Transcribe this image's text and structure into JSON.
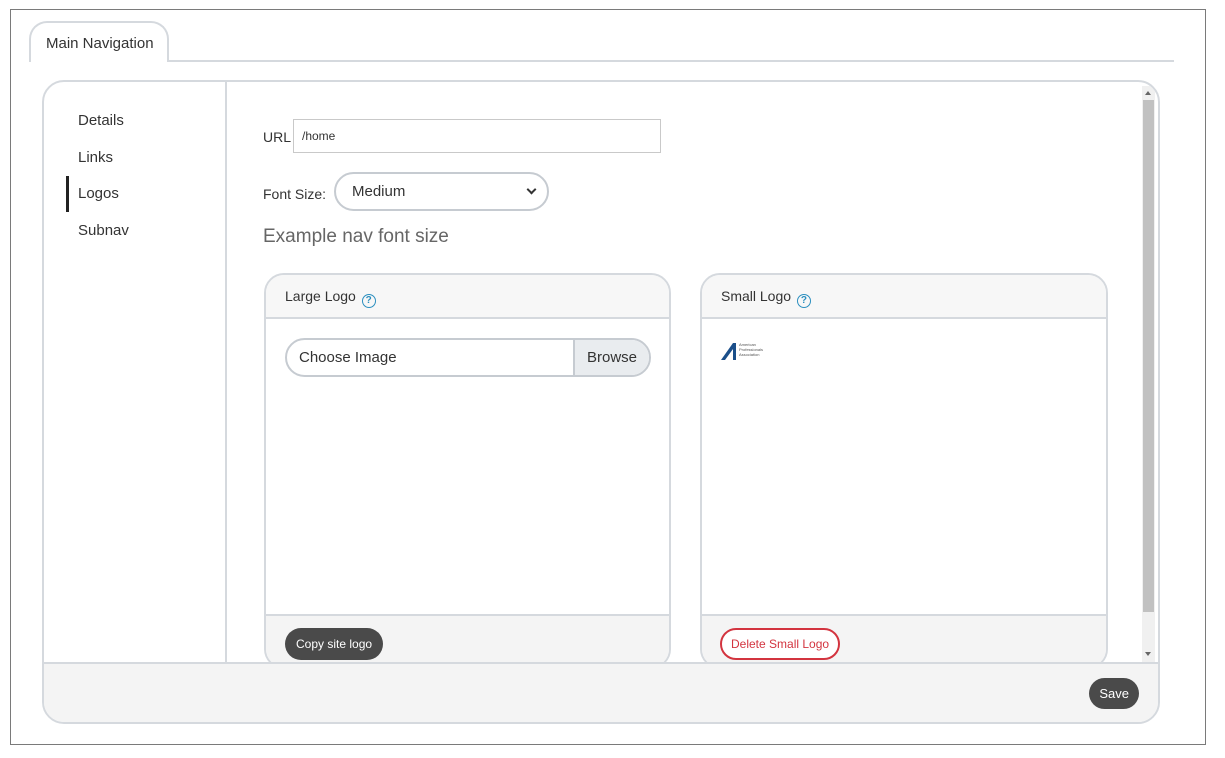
{
  "tabs": [
    {
      "label": "Main Navigation"
    }
  ],
  "sidebar": {
    "items": [
      {
        "label": "Details",
        "active": false
      },
      {
        "label": "Links",
        "active": false
      },
      {
        "label": "Logos",
        "active": true
      },
      {
        "label": "Subnav",
        "active": false
      }
    ]
  },
  "form": {
    "url_label": "URL",
    "url_value": "/home",
    "font_size_label": "Font Size:",
    "font_size_value": "Medium",
    "example_text": "Example nav font size"
  },
  "large_logo": {
    "title": "Large Logo",
    "file_placeholder": "Choose Image",
    "browse_label": "Browse",
    "copy_label": "Copy site logo"
  },
  "small_logo": {
    "title": "Small Logo",
    "logo_text": [
      "American",
      "Professionals",
      "Association"
    ],
    "delete_label": "Delete Small Logo"
  },
  "footer": {
    "save_label": "Save"
  },
  "colors": {
    "accent_danger": "#d3343f",
    "help_icon": "#2c8fbf",
    "button_dark": "#4a4a4a",
    "logo_blue": "#1b4f8a"
  }
}
